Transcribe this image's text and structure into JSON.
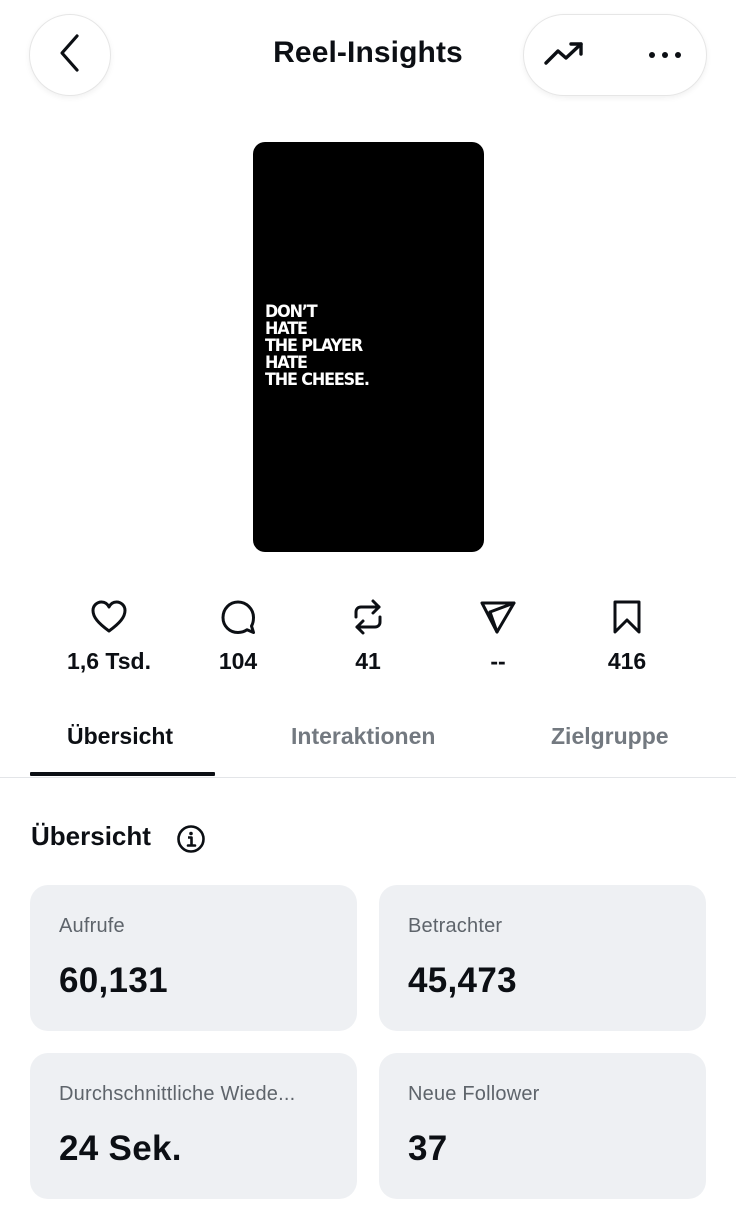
{
  "header": {
    "title": "Reel-Insights",
    "back_icon": "chevron-left-icon",
    "trend_icon": "trending-up-icon",
    "more_icon": "more-horizontal-icon"
  },
  "thumbnail": {
    "lines": [
      "DON’T",
      "HATE",
      "THE PLAYER",
      "HATE",
      "THE CHEESE."
    ],
    "background": "#000000"
  },
  "stats": [
    {
      "icon": "heart-icon",
      "value": "1,6 Tsd."
    },
    {
      "icon": "comment-icon",
      "value": "104"
    },
    {
      "icon": "repost-icon",
      "value": "41"
    },
    {
      "icon": "share-icon",
      "value": "--"
    },
    {
      "icon": "bookmark-icon",
      "value": "416"
    }
  ],
  "tabs": [
    {
      "label": "Übersicht",
      "active": true
    },
    {
      "label": "Interaktionen",
      "active": false
    },
    {
      "label": "Zielgruppe",
      "active": false
    }
  ],
  "overview": {
    "title": "Übersicht",
    "info_icon": "info-icon",
    "cards": [
      {
        "label": "Aufrufe",
        "value": "60,131"
      },
      {
        "label": "Betrachter",
        "value": "45,473"
      },
      {
        "label": "Durchschnittliche Wiede...",
        "value": "24 Sek."
      },
      {
        "label": "Neue Follower",
        "value": "37"
      }
    ]
  },
  "colors": {
    "text": "#0c0f14",
    "muted": "#737980",
    "card_bg": "#eef0f3",
    "divider": "#e3e5e8"
  }
}
